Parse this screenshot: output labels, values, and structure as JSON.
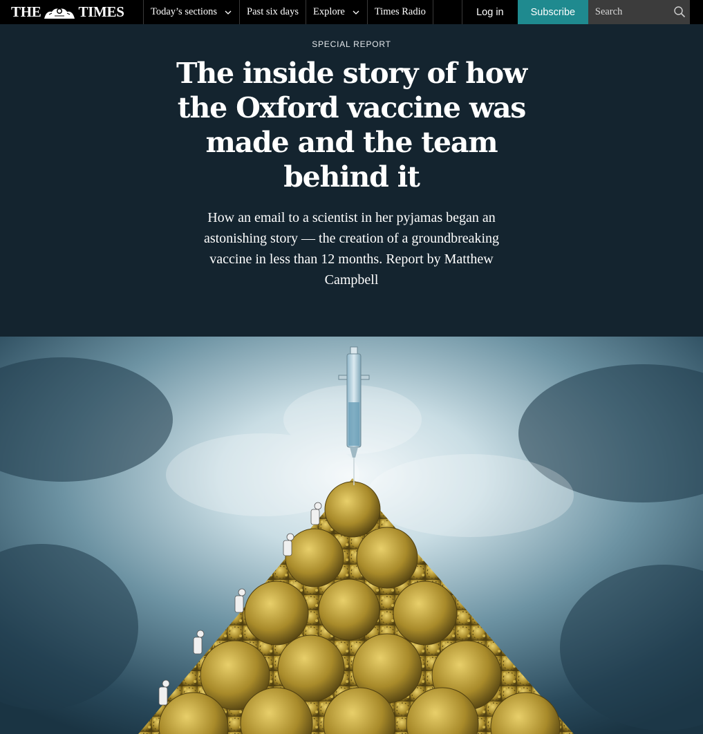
{
  "nav": {
    "logo_left": "THE",
    "logo_right": "TIMES",
    "items": [
      {
        "label": "Today’s sections",
        "has_dropdown": true
      },
      {
        "label": "Past six days",
        "has_dropdown": false
      },
      {
        "label": "Explore",
        "has_dropdown": true
      },
      {
        "label": "Times Radio",
        "has_dropdown": false
      }
    ],
    "login_label": "Log in",
    "subscribe_label": "Subscribe",
    "search_placeholder": "Search"
  },
  "article": {
    "kicker": "SPECIAL REPORT",
    "headline": "The inside story of how the Oxford vaccine was made and the team behind it",
    "standfirst": "How an email to a scientist in her pyjamas began an astonishing story — the creation of a groundbreaking vaccine in less than 12 months. Report by Matthew Campbell"
  },
  "colors": {
    "nav_bg": "#000000",
    "hero_bg": "#14242f",
    "subscribe_bg": "#1f8a8f",
    "search_bg": "#3c3c3c"
  },
  "icons": [
    "chevron-down-icon",
    "search-icon",
    "crest-icon"
  ]
}
